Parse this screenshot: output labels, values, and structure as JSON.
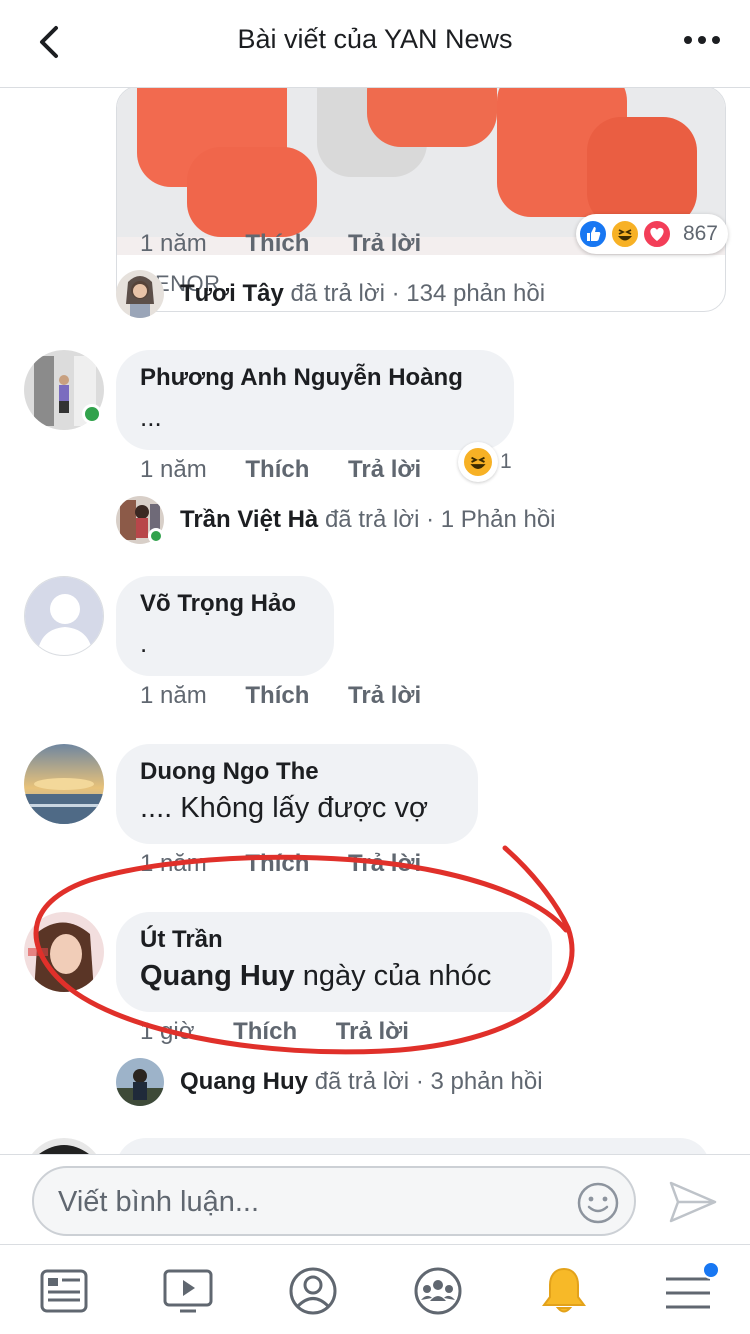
{
  "header": {
    "title": "Bài viết của YAN News"
  },
  "media": {
    "source_label": "TENOR",
    "reactions_count": "867",
    "reactions": [
      "like",
      "haha",
      "love"
    ]
  },
  "first_comment_actions": {
    "time": "1 năm",
    "like": "Thích",
    "reply": "Trả lời"
  },
  "first_reply_summary": {
    "name": "Tươi Tây",
    "action": "đã trả lời",
    "count": "· 134 phản hồi"
  },
  "comments": [
    {
      "name": "Phương Anh Nguyễn Hoàng",
      "text": "...",
      "time": "1 năm",
      "like": "Thích",
      "reply": "Trả lời",
      "reaction_count": "1",
      "reply_summary": {
        "name": "Trần Việt Hà",
        "action": "đã trả lời",
        "count": "· 1 Phản hồi"
      }
    },
    {
      "name": "Võ Trọng Hảo",
      "text": ".",
      "time": "1 năm",
      "like": "Thích",
      "reply": "Trả lời"
    },
    {
      "name": "Duong Ngo The",
      "text": ".... Không lấy được vợ",
      "time": "1 năm",
      "like": "Thích",
      "reply": "Trả lời"
    },
    {
      "name": "Út Trần",
      "mention": "Quang Huy",
      "text": " ngày của nhóc",
      "time": "1 giờ",
      "like": "Thích",
      "reply": "Trả lời",
      "reply_summary": {
        "name": "Quang Huy",
        "action": "đã trả lời",
        "count": "· 3 phản hồi"
      }
    }
  ],
  "composer": {
    "placeholder": "Viết bình luận..."
  },
  "tabbar": {
    "items": [
      "news-feed",
      "watch",
      "profile",
      "groups",
      "notifications",
      "menu"
    ],
    "notifications_color": "#f7b928",
    "accent": "#1877f2"
  },
  "colors": {
    "annotation": "#e0302a",
    "online": "#31a24c"
  }
}
